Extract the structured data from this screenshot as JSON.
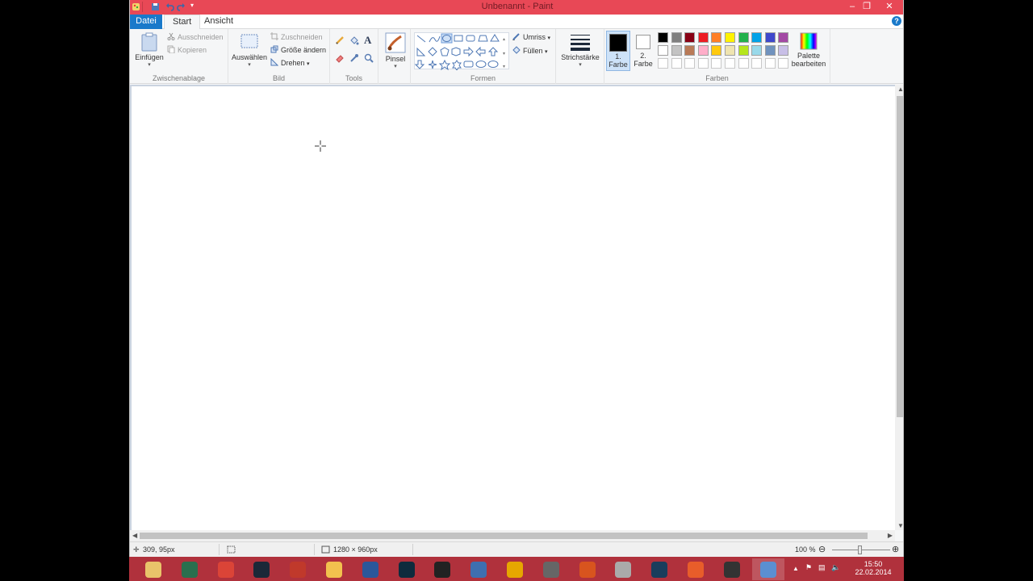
{
  "window": {
    "title": "Unbenannt - Paint"
  },
  "tabs": {
    "file": "Datei",
    "start": "Start",
    "view": "Ansicht"
  },
  "ribbon": {
    "clipboard": {
      "paste": "Einfügen",
      "cut": "Ausschneiden",
      "copy": "Kopieren",
      "group": "Zwischenablage"
    },
    "image": {
      "select": "Auswählen",
      "crop": "Zuschneiden",
      "resize": "Größe ändern",
      "rotate": "Drehen",
      "group": "Bild"
    },
    "tools": {
      "group": "Tools",
      "text_glyph": "A"
    },
    "brushes": {
      "label": "Pinsel"
    },
    "shapes": {
      "outline": "Umriss",
      "fill": "Füllen",
      "group": "Formen"
    },
    "size": {
      "label": "Strichstärke"
    },
    "colors": {
      "color1_num": "1.",
      "color1_label": "Farbe",
      "color2_num": "2.",
      "color2_label": "Farbe",
      "edit_line1": "Palette",
      "edit_line2": "bearbeiten",
      "group": "Farben",
      "palette_row1": [
        "#000000",
        "#7f7f7f",
        "#880015",
        "#ed1c24",
        "#ff7f27",
        "#fff200",
        "#22b14c",
        "#00a2e8",
        "#3f48cc",
        "#a349a4"
      ],
      "palette_row2": [
        "#ffffff",
        "#c3c3c3",
        "#b97a57",
        "#ffaec9",
        "#ffc90e",
        "#efe4b0",
        "#b5e61d",
        "#99d9ea",
        "#7092be",
        "#c8bfe7"
      ]
    }
  },
  "status": {
    "cursor_pos": "309, 95px",
    "canvas_size": "1280 × 960px",
    "zoom": "100 %"
  },
  "taskbar": {
    "time": "15:50",
    "date": "22.02.2014",
    "icons": [
      "explorer-icon",
      "media-icon",
      "chrome-icon",
      "steam-icon",
      "app-red-icon",
      "tool-yellow-icon",
      "word-icon",
      "league-icon",
      "obs-icon",
      "virtualbox-icon",
      "dropbox-icon",
      "gun-icon",
      "origin-icon",
      "disc-icon",
      "league2-icon",
      "orange-icon",
      "movie-icon",
      "paint-icon"
    ]
  }
}
